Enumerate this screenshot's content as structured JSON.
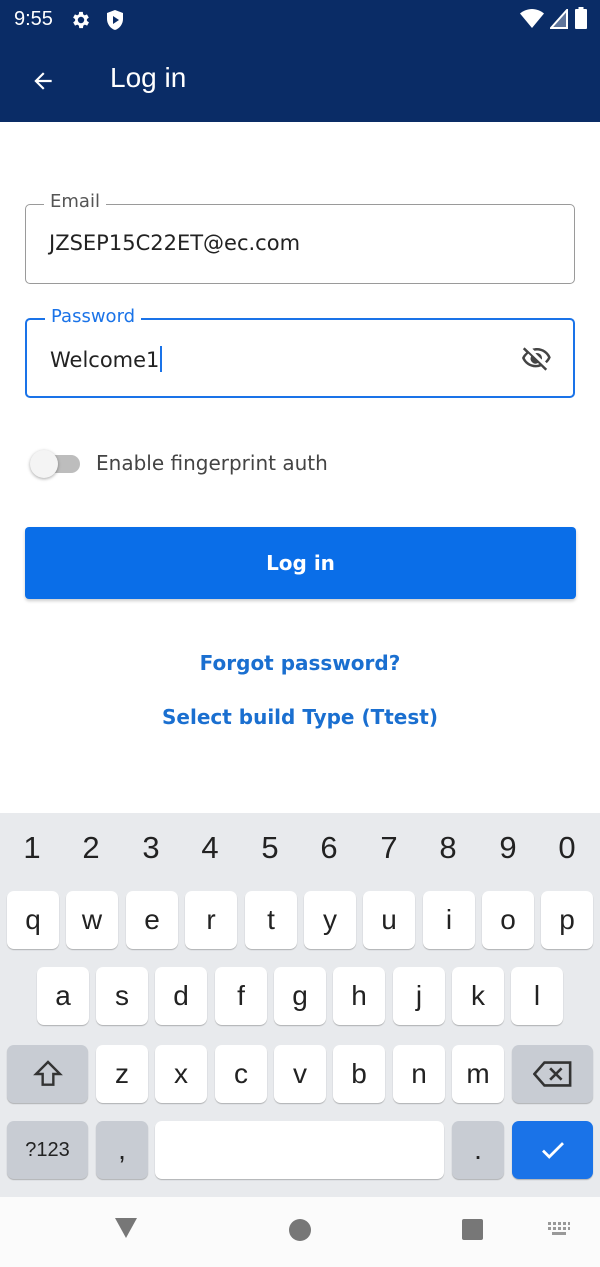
{
  "status_bar": {
    "time": "9:55"
  },
  "app_bar": {
    "title": "Log in"
  },
  "form": {
    "email_label": "Email",
    "email_value": "JZSEP15C22ET@ec.com",
    "password_label": "Password",
    "password_value": "Welcome1",
    "fingerprint_label": "Enable fingerprint auth",
    "fingerprint_enabled": false,
    "login_label": "Log in",
    "forgot_link": "Forgot password?",
    "build_link": "Select build Type (Ttest)"
  },
  "colors": {
    "app_bar": "#0a2c66",
    "primary_button": "#0a6ee8",
    "link": "#1a6fd0",
    "focus_border": "#1a73e8"
  },
  "keyboard": {
    "numbers": [
      "1",
      "2",
      "3",
      "4",
      "5",
      "6",
      "7",
      "8",
      "9",
      "0"
    ],
    "row1": [
      "q",
      "w",
      "e",
      "r",
      "t",
      "y",
      "u",
      "i",
      "o",
      "p"
    ],
    "row2": [
      "a",
      "s",
      "d",
      "f",
      "g",
      "h",
      "j",
      "k",
      "l"
    ],
    "row3": [
      "z",
      "x",
      "c",
      "v",
      "b",
      "n",
      "m"
    ],
    "symbols_key": "?123",
    "comma_key": ",",
    "period_key": ".",
    "icons": {
      "shift": "shift-icon",
      "backspace": "backspace-icon",
      "done": "check-icon"
    }
  }
}
